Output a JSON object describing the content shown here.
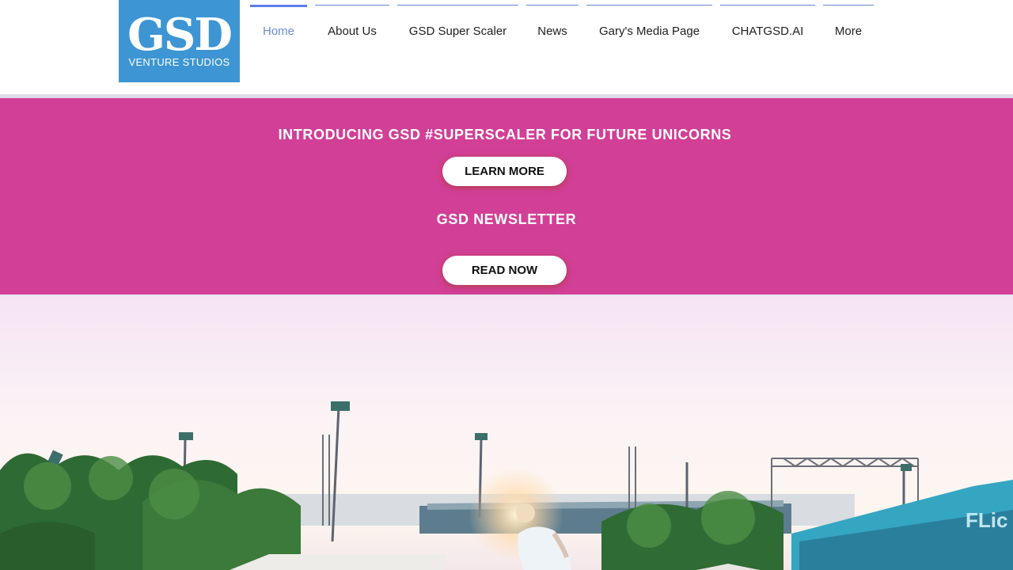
{
  "logo": {
    "main": "GSD",
    "sub": "VENTURE STUDIOS",
    "bg_color": "#3d95d3"
  },
  "nav": {
    "items": [
      {
        "label": "Home",
        "active": true
      },
      {
        "label": "About Us"
      },
      {
        "label": "GSD Super Scaler"
      },
      {
        "label": "News"
      },
      {
        "label": "Gary's Media Page"
      },
      {
        "label": "CHATGSD.AI"
      },
      {
        "label": "More"
      }
    ],
    "active_color": "#5a7de8"
  },
  "banner": {
    "bg_color": "#d23f96",
    "title": "INTRODUCING GSD #SUPERSCALER FOR FUTURE UNICORNS",
    "learn_more": "LEARN MORE",
    "newsletter_title": "GSD NEWSLETTER",
    "read_now": "READ NOW"
  },
  "photo": {
    "sign_text": "FLic"
  }
}
